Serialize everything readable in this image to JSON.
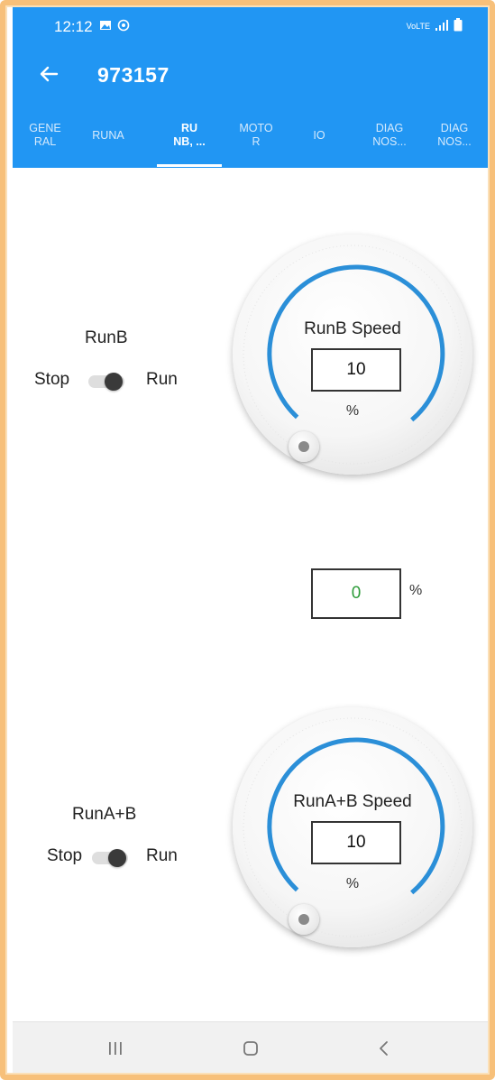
{
  "status_bar": {
    "time": "12:12",
    "right_text": "VoLTE",
    "icons": [
      "gallery-icon",
      "settings-icon",
      "signal-icon",
      "battery-icon"
    ]
  },
  "app_bar": {
    "title": "973157",
    "back_icon": "arrow-left-icon"
  },
  "tabs": [
    {
      "label": "GENE\nRAL",
      "active": false
    },
    {
      "label": "RUNA",
      "active": false
    },
    {
      "label": "RU\nNB, ...",
      "active": true
    },
    {
      "label": "MOTO\nR",
      "active": false
    },
    {
      "label": "IO",
      "active": false
    },
    {
      "label": "DIAG\nNOS...",
      "active": false
    },
    {
      "label": "DIAG\nNOS...",
      "active": false
    }
  ],
  "runb": {
    "label": "RunB",
    "stop_label": "Stop",
    "run_label": "Run",
    "knob_title": "RunB Speed",
    "knob_value": "10",
    "knob_unit": "%"
  },
  "middle": {
    "value": "0",
    "unit": "%",
    "value_color": "#2e9c3a"
  },
  "runab": {
    "label": "RunA+B",
    "stop_label": "Stop",
    "run_label": "Run",
    "knob_title": "RunA+B Speed",
    "knob_value": "10",
    "knob_unit": "%"
  },
  "nav_bar": {
    "icons": [
      "recent-apps-icon",
      "home-icon",
      "back-icon"
    ]
  },
  "colors": {
    "primary": "#2196f3",
    "accent_arc": "#2b8fd8"
  }
}
